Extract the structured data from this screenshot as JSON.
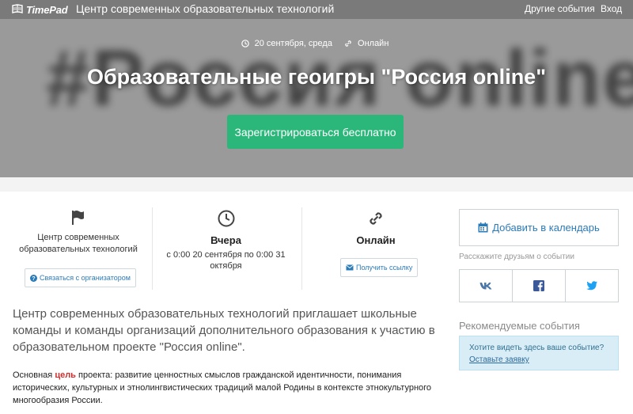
{
  "topbar": {
    "logo_text": "TimePad",
    "org_title": "Центр современных образовательных технологий",
    "nav_other": "Другие события",
    "nav_login": "Вход"
  },
  "hero": {
    "background_text": "#Россия online",
    "date": "20 сентября, среда",
    "location": "Онлайн",
    "title": "Образовательные геоигры \"Россия online\"",
    "register_label": "Зарегистрироваться бесплатно"
  },
  "info": {
    "organizer": {
      "name": "Центр современных образовательных технологий",
      "contact_label": "Связаться с организатором"
    },
    "time": {
      "heading": "Вчера",
      "detail": "с 0:00 20 сентября по 0:00 31 октября"
    },
    "place": {
      "heading": "Онлайн",
      "link_label": "Получить ссылку"
    }
  },
  "description": {
    "lead": "Центр современных образовательных технологий приглашает школьные команды и команды организаций дополнительного образования к участию в образовательном проекте \"Россия online\".",
    "goal_prefix": "Основная ",
    "goal_word": "цель",
    "goal_rest": " проекта: развитие ценностных смыслов гражданской идентичности, понимания исторических, культурных и этнолингвистических традиций малой Родины в контексте этнокультурного многообразия России."
  },
  "sidebar": {
    "calendar_label": "Добавить в календарь",
    "share_label": "Расскажите друзьям о событии",
    "share_icons": [
      "vk-icon",
      "facebook-icon",
      "twitter-icon"
    ],
    "recommended_label": "Рекомендуемые события",
    "promo_text": "Хотите видеть здесь ваше событие?",
    "promo_link": "Оставьте заявку"
  },
  "colors": {
    "topbar": "#7a7a7a",
    "hero": "#9a9a9a",
    "register_button": "#2bb77a",
    "link": "#2b7bb9",
    "accent": "#d62b2b",
    "vk": "#4a76a8",
    "facebook": "#3b5998",
    "twitter": "#1da1f2",
    "promo_bg": "#d9edf7"
  }
}
